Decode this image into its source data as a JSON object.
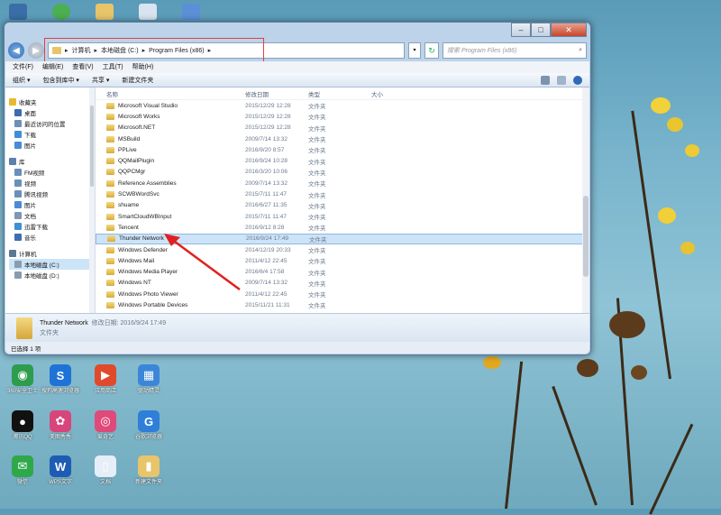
{
  "window": {
    "address_path": [
      "计算机",
      "本地磁盘 (C:)",
      "Program Files (x86)"
    ],
    "search_placeholder": "搜索 Program Files (x86)",
    "menu": [
      "文件(F)",
      "编辑(E)",
      "查看(V)",
      "工具(T)",
      "帮助(H)"
    ],
    "toolbar": [
      "组织 ▾",
      "包含到库中 ▾",
      "共享 ▾",
      "新建文件夹"
    ],
    "columns": {
      "name": "名称",
      "date": "修改日期",
      "type": "类型",
      "size": "大小"
    },
    "nav": [
      {
        "label": "收藏夹",
        "top": true,
        "color": "#e8b830"
      },
      {
        "label": "桌面",
        "top": false,
        "color": "#3c6bb0"
      },
      {
        "label": "最近访问的位置",
        "top": false,
        "color": "#6b8fb9"
      },
      {
        "label": "下载",
        "top": false,
        "color": "#3f8fd6"
      },
      {
        "label": "图片",
        "top": false,
        "color": "#4a8ad8"
      },
      {
        "label": "库",
        "top": true,
        "color": "#5c7fae"
      },
      {
        "label": "FM视频",
        "top": false,
        "color": "#6b8fb9"
      },
      {
        "label": "视频",
        "top": false,
        "color": "#6b8fb9"
      },
      {
        "label": "腾讯视频",
        "top": false,
        "color": "#6b8fb9"
      },
      {
        "label": "图片",
        "top": false,
        "color": "#4a8ad8"
      },
      {
        "label": "文档",
        "top": false,
        "color": "#7f97b5"
      },
      {
        "label": "迅雷下载",
        "top": false,
        "color": "#3f8fd6"
      },
      {
        "label": "音乐",
        "top": false,
        "color": "#3f6fb0"
      },
      {
        "label": "计算机",
        "top": true,
        "color": "#5a7896"
      },
      {
        "label": "本地磁盘 (C:)",
        "top": false,
        "color": "#8a9bb0",
        "selected": true
      },
      {
        "label": "本地磁盘 (D:)",
        "top": false,
        "color": "#8a9bb0"
      }
    ],
    "files": [
      {
        "name": "Microsoft Visual Studio",
        "date": "2015/12/29 12:28",
        "type": "文件夹"
      },
      {
        "name": "Microsoft Works",
        "date": "2015/12/29 12:28",
        "type": "文件夹"
      },
      {
        "name": "Microsoft.NET",
        "date": "2015/12/29 12:28",
        "type": "文件夹"
      },
      {
        "name": "MSBuild",
        "date": "2009/7/14 13:32",
        "type": "文件夹"
      },
      {
        "name": "PPLive",
        "date": "2016/9/20 8:57",
        "type": "文件夹"
      },
      {
        "name": "QQMailPlugin",
        "date": "2016/9/24 10:28",
        "type": "文件夹"
      },
      {
        "name": "QQPCMgr",
        "date": "2016/3/20 10:06",
        "type": "文件夹"
      },
      {
        "name": "Reference Assemblies",
        "date": "2009/7/14 13:32",
        "type": "文件夹"
      },
      {
        "name": "SCWBWordSvc",
        "date": "2015/7/11 11:47",
        "type": "文件夹"
      },
      {
        "name": "shuame",
        "date": "2016/6/27 11:35",
        "type": "文件夹"
      },
      {
        "name": "SmartCloudWBInput",
        "date": "2015/7/11 11:47",
        "type": "文件夹"
      },
      {
        "name": "Tencent",
        "date": "2016/9/12 8:28",
        "type": "文件夹"
      },
      {
        "name": "Thunder Network",
        "date": "2016/9/24 17:49",
        "type": "文件夹",
        "selected": true
      },
      {
        "name": "Windows Defender",
        "date": "2014/12/19 20:33",
        "type": "文件夹"
      },
      {
        "name": "Windows Mail",
        "date": "2011/4/12 22:45",
        "type": "文件夹"
      },
      {
        "name": "Windows Media Player",
        "date": "2016/6/4 17:58",
        "type": "文件夹"
      },
      {
        "name": "Windows NT",
        "date": "2009/7/14 13:32",
        "type": "文件夹"
      },
      {
        "name": "Windows Photo Viewer",
        "date": "2011/4/12 22:45",
        "type": "文件夹"
      },
      {
        "name": "Windows Portable Devices",
        "date": "2015/11/21 11:31",
        "type": "文件夹"
      }
    ],
    "details": {
      "name": "Thunder Network",
      "modified_label": "修改日期: 2016/9/24 17:49",
      "type": "文件夹"
    },
    "status": "已选择 1 项"
  },
  "desktop_icons": [
    {
      "label": "360安全卫士",
      "color": "#2e9c4d",
      "glyph": "◉"
    },
    {
      "label": "搜狗高速浏览器",
      "color": "#1f73d6",
      "glyph": "S"
    },
    {
      "label": "应用商店",
      "color": "#e04a2a",
      "glyph": "▶"
    },
    {
      "label": "驱动精灵",
      "color": "#3b86d8",
      "glyph": "▦"
    },
    {
      "label": "腾讯QQ",
      "color": "#111111",
      "glyph": "●"
    },
    {
      "label": "美图秀秀",
      "color": "#d8457a",
      "glyph": "✿"
    },
    {
      "label": "爱奇艺",
      "color": "#e04a7a",
      "glyph": "◎"
    },
    {
      "label": "谷歌浏览器",
      "color": "#2f7fd8",
      "glyph": "G"
    },
    {
      "label": "微信",
      "color": "#2fa84a",
      "glyph": "✉"
    },
    {
      "label": "WPS文字",
      "color": "#1e5cb3",
      "glyph": "W"
    },
    {
      "label": "文档",
      "color": "#e6eef7",
      "glyph": "▯"
    },
    {
      "label": "新建文件夹",
      "color": "#e8c46a",
      "glyph": "▮"
    }
  ]
}
